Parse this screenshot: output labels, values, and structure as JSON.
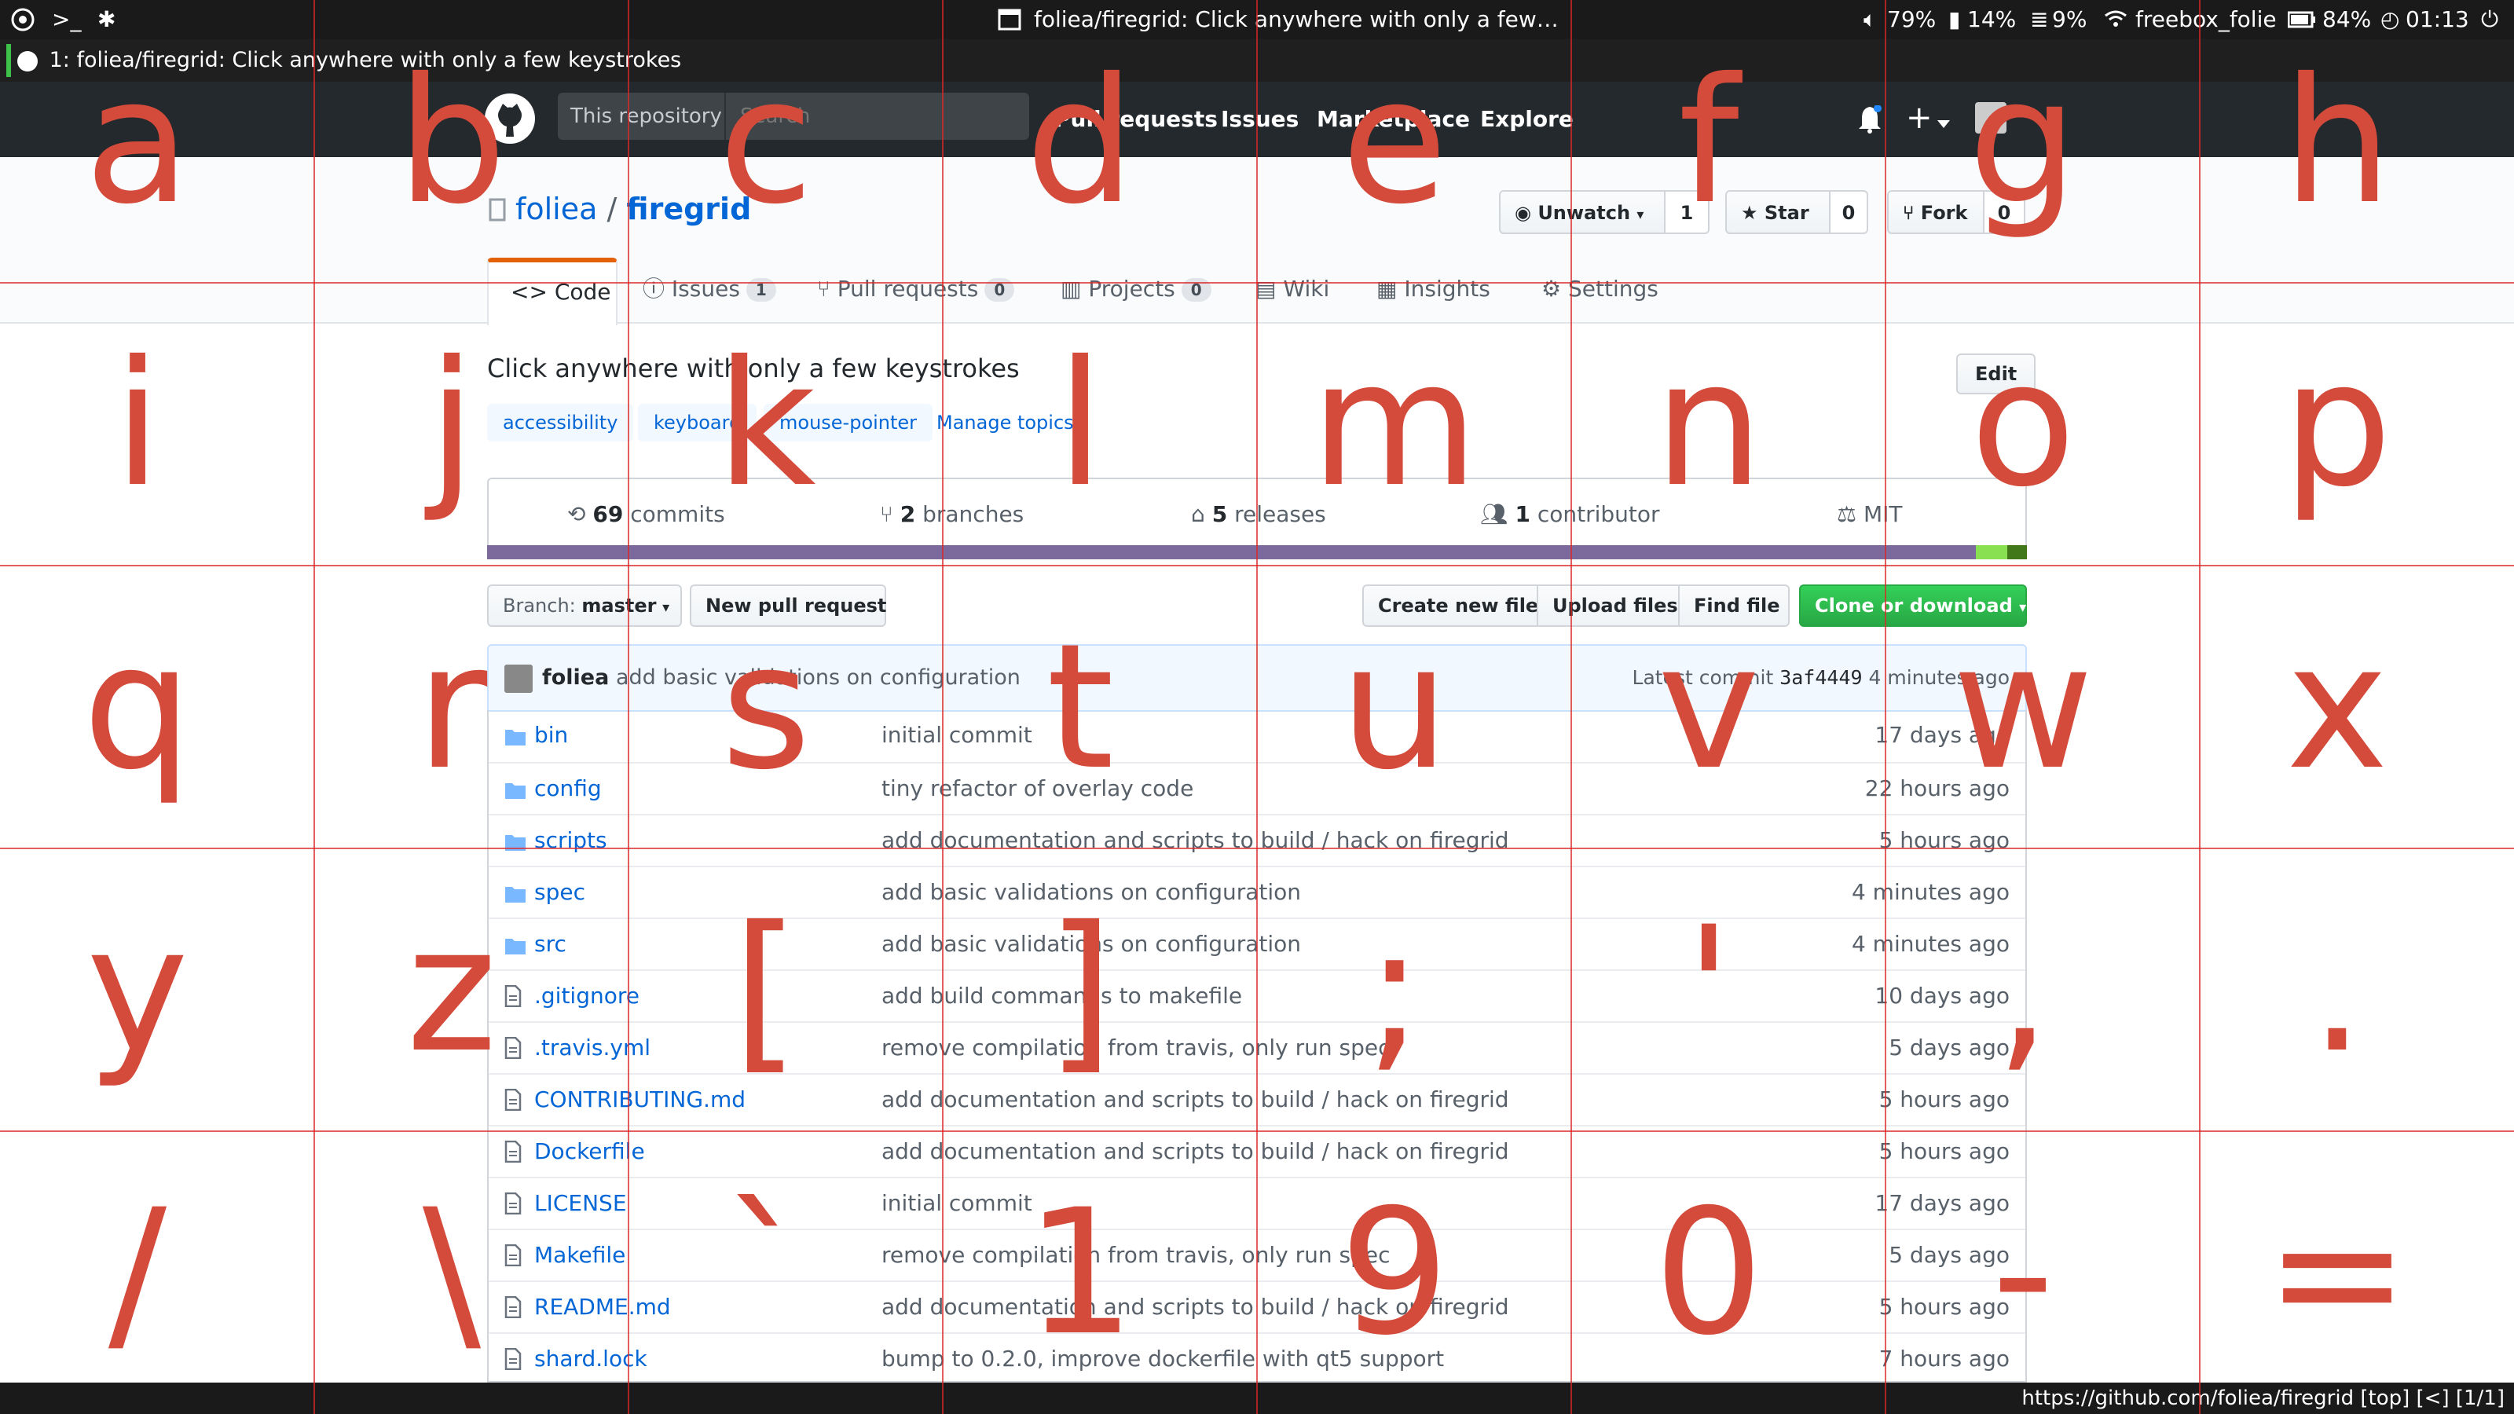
{
  "system_bar": {
    "window_title": "foliea/firegrid: Click anywhere with only a few…",
    "volume": "79%",
    "memory": "14%",
    "disk": "9%",
    "wifi": "freebox_folie",
    "battery": "84%",
    "clock": "01:13"
  },
  "browser_tab": {
    "title": "1: foliea/firegrid: Click anywhere with only a few keystrokes"
  },
  "header": {
    "search_scope": "This repository",
    "search_placeholder": "Search",
    "nav": [
      "Pull requests",
      "Issues",
      "Marketplace",
      "Explore"
    ],
    "plus": "+"
  },
  "repo": {
    "owner": "foliea",
    "separator": "/",
    "name": "firegrid",
    "unwatch_label": "Unwatch",
    "watch_count": "1",
    "star_label": "Star",
    "star_count": "0",
    "fork_label": "Fork",
    "fork_count": "0",
    "tabs": {
      "code": "Code",
      "issues": "Issues",
      "issues_count": "1",
      "pulls": "Pull requests",
      "pulls_count": "0",
      "projects": "Projects",
      "projects_count": "0",
      "wiki": "Wiki",
      "insights": "Insights",
      "settings": "Settings"
    },
    "description": "Click anywhere with only a few keystrokes",
    "edit_label": "Edit",
    "topics": [
      "accessibility",
      "keyboard",
      "mouse-pointer"
    ],
    "manage_topics": "Manage topics",
    "summary": {
      "commits_num": "69",
      "commits_label": "commits",
      "branches_num": "2",
      "branches_label": "branches",
      "releases_num": "5",
      "releases_label": "releases",
      "contributors_num": "1",
      "contributors_label": "contributor",
      "license": "MIT"
    },
    "languages": [
      {
        "color": "#7d6a9c",
        "share": 96.7
      },
      {
        "color": "#89e051",
        "share": 2.0
      },
      {
        "color": "#427819",
        "share": 1.3
      }
    ]
  },
  "file_nav": {
    "branch_prefix": "Branch:",
    "branch": "master",
    "new_pr": "New pull request",
    "create_file": "Create new file",
    "upload": "Upload files",
    "find": "Find file",
    "clone": "Clone or download"
  },
  "latest_commit": {
    "author": "foliea",
    "message": "add basic validations on configuration",
    "prefix": "Latest commit",
    "sha": "3af4449",
    "age": "4 minutes ago"
  },
  "files": [
    {
      "name": "bin",
      "type": "dir",
      "message": "initial commit",
      "age": "17 days ago"
    },
    {
      "name": "config",
      "type": "dir",
      "message": "tiny refactor of overlay code",
      "age": "22 hours ago"
    },
    {
      "name": "scripts",
      "type": "dir",
      "message": "add documentation and scripts to build / hack on firegrid",
      "age": "5 hours ago"
    },
    {
      "name": "spec",
      "type": "dir",
      "message": "add basic validations on configuration",
      "age": "4 minutes ago"
    },
    {
      "name": "src",
      "type": "dir",
      "message": "add basic validations on configuration",
      "age": "4 minutes ago"
    },
    {
      "name": ".gitignore",
      "type": "file",
      "message": "add build commands to makefile",
      "age": "10 days ago"
    },
    {
      "name": ".travis.yml",
      "type": "file",
      "message": "remove compilation from travis, only run spec",
      "age": "5 days ago"
    },
    {
      "name": "CONTRIBUTING.md",
      "type": "file",
      "message": "add documentation and scripts to build / hack on firegrid",
      "age": "5 hours ago"
    },
    {
      "name": "Dockerfile",
      "type": "file",
      "message": "add documentation and scripts to build / hack on firegrid",
      "age": "5 hours ago"
    },
    {
      "name": "LICENSE",
      "type": "file",
      "message": "initial commit",
      "age": "17 days ago"
    },
    {
      "name": "Makefile",
      "type": "file",
      "message": "remove compilation from travis, only run spec",
      "age": "5 days ago"
    },
    {
      "name": "README.md",
      "type": "file",
      "message": "add documentation and scripts to build / hack on firegrid",
      "age": "5 hours ago"
    },
    {
      "name": "shard.lock",
      "type": "file",
      "message": "bump to 0.2.0, improve dockerfile with qt5 support",
      "age": "7 hours ago"
    }
  ],
  "status_line": "https://github.com/foliea/firegrid [top] [<] [1/1]",
  "hint_grid": {
    "columns": 8,
    "rows": 5,
    "keys": [
      "a",
      "b",
      "c",
      "d",
      "e",
      "f",
      "g",
      "h",
      "i",
      "j",
      "k",
      "l",
      "m",
      "n",
      "o",
      "p",
      "q",
      "r",
      "s",
      "t",
      "u",
      "v",
      "w",
      "x",
      "y",
      "z",
      "[",
      "]",
      ";",
      "'",
      ",",
      ".",
      "/",
      "\\",
      "`",
      "1",
      "9",
      "0",
      "-",
      "="
    ]
  },
  "colors": {
    "accent": "#e36209",
    "link": "#0366d6",
    "hint": "#d44b3b",
    "header_bg": "#24292e",
    "clone_green": "#28a745"
  }
}
